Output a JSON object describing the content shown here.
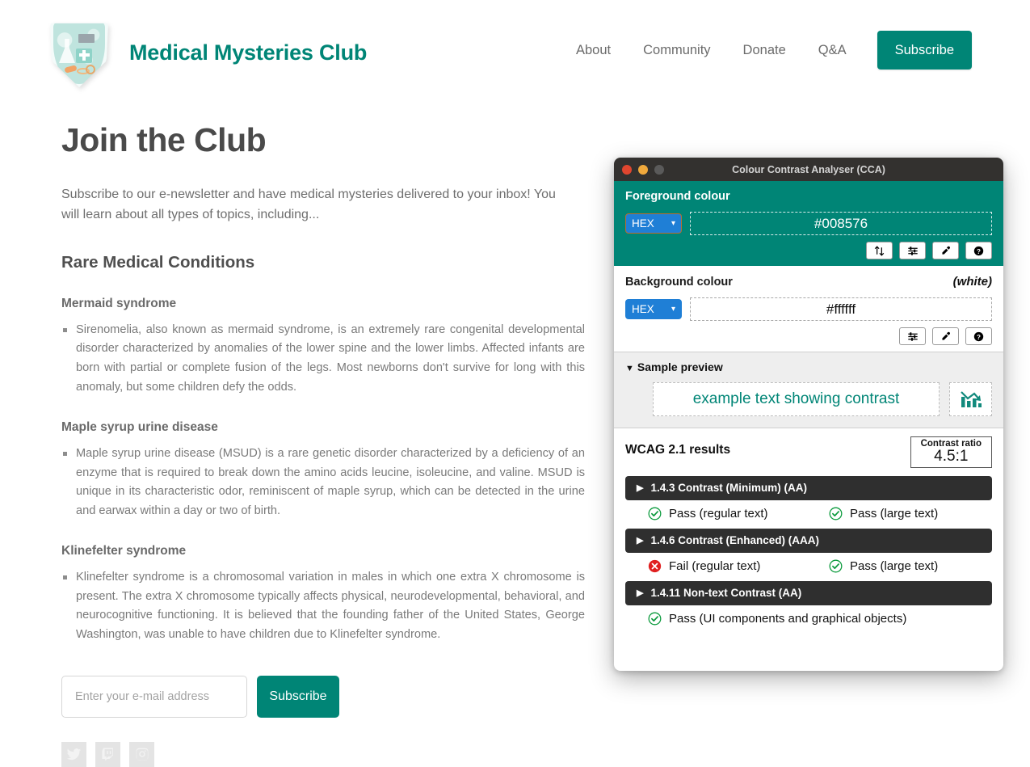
{
  "site": {
    "brand": {
      "title": "Medical Mysteries Club",
      "logo_icon": "shield-lab-icon"
    },
    "nav": {
      "links": [
        {
          "label": "About",
          "name": "nav-link-about"
        },
        {
          "label": "Community",
          "name": "nav-link-community"
        },
        {
          "label": "Donate",
          "name": "nav-link-donate"
        },
        {
          "label": "Q&A",
          "name": "nav-link-qa"
        }
      ],
      "subscribe_label": "Subscribe"
    },
    "page_title": "Join the Club",
    "intro": "Subscribe to our e-newsletter and have medical mysteries delivered to your inbox! You will learn about all types of topics, including...",
    "section_heading": "Rare Medical Conditions",
    "topics": [
      {
        "title": "Mermaid syndrome",
        "body": "Sirenomelia, also known as mermaid syndrome, is an extremely rare congenital developmental disorder characterized by anomalies of the lower spine and the lower limbs. Affected infants are born with partial or complete fusion of the legs. Most newborns don't survive for long with this anomaly, but some children defy the odds."
      },
      {
        "title": "Maple syrup urine disease",
        "body": "Maple syrup urine disease (MSUD) is a rare genetic disorder characterized by a deficiency of an enzyme that is required to break down the amino acids leucine, isoleucine, and valine. MSUD is unique in its characteristic odor, reminiscent of maple syrup, which can be detected in the urine and earwax within a day or two of birth."
      },
      {
        "title": "Klinefelter syndrome",
        "body": "Klinefelter syndrome is a chromosomal variation in males in which one extra X chromosome is present. The extra X chromosome typically affects physical, neurodevelopmental, behavioral, and neurocognitive functioning. It is believed that the founding father of the United States, George Washington, was unable to have children due to Klinefelter syndrome."
      }
    ],
    "form": {
      "email_placeholder": "Enter your e-mail address",
      "email_value": "",
      "submit_label": "Subscribe"
    },
    "social": [
      {
        "name": "twitter-icon",
        "label": "Twitter"
      },
      {
        "name": "twitch-icon",
        "label": "Twitch"
      },
      {
        "name": "instagram-icon",
        "label": "Instagram"
      }
    ],
    "colors": {
      "brand_teal": "#008576",
      "body_text": "#7a7a7a",
      "heading": "#4a4a4a"
    }
  },
  "cca": {
    "window_title": "Colour Contrast Analyser (CCA)",
    "traffic_lights": [
      "close-button",
      "minimize-button",
      "maximize-button"
    ],
    "foreground": {
      "label": "Foreground colour",
      "format": "HEX",
      "value": "#008576",
      "buttons": [
        {
          "name": "swap-colours-button",
          "icon": "up-down-arrows-icon"
        },
        {
          "name": "colour-sliders-button",
          "icon": "sliders-icon"
        },
        {
          "name": "eyedropper-button",
          "icon": "eyedropper-icon"
        },
        {
          "name": "help-button",
          "icon": "question-mark-icon"
        }
      ]
    },
    "background": {
      "label": "Background colour",
      "note": "(white)",
      "format": "HEX",
      "value": "#ffffff",
      "buttons": [
        {
          "name": "colour-sliders-button",
          "icon": "sliders-icon"
        },
        {
          "name": "eyedropper-button",
          "icon": "eyedropper-icon"
        },
        {
          "name": "help-button",
          "icon": "question-mark-icon"
        }
      ]
    },
    "preview": {
      "toggle_label": "Sample preview",
      "caret": "▼",
      "sample_text": "example text showing contrast",
      "graphic_icon": "bar-chart-declining-icon"
    },
    "wcag": {
      "title": "WCAG 2.1 results",
      "contrast_ratio_label": "Contrast ratio",
      "contrast_ratio_value": "4.5:1",
      "criteria": [
        {
          "caret": "▶",
          "title": "1.4.3 Contrast (Minimum) (AA)",
          "results": [
            {
              "status": "pass",
              "text": "Pass (regular text)"
            },
            {
              "status": "pass",
              "text": "Pass (large text)"
            }
          ]
        },
        {
          "caret": "▶",
          "title": "1.4.6 Contrast (Enhanced) (AAA)",
          "results": [
            {
              "status": "fail",
              "text": "Fail (regular text)"
            },
            {
              "status": "pass",
              "text": "Pass (large text)"
            }
          ]
        },
        {
          "caret": "▶",
          "title": "1.4.11 Non-text Contrast (AA)",
          "results": [
            {
              "status": "pass",
              "text": "Pass (UI components and graphical objects)"
            }
          ]
        }
      ],
      "colors": {
        "pass": "#0a9a3c",
        "fail": "#e02020",
        "header_bg": "#2f2f2f"
      }
    }
  }
}
